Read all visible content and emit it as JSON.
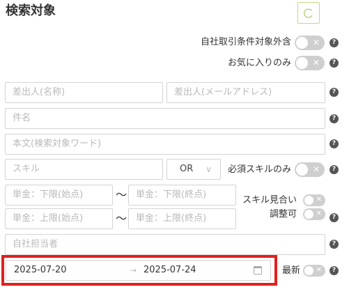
{
  "panel": {
    "title": "検索対象"
  },
  "reset": {
    "icon": "refresh-icon"
  },
  "toggles": {
    "exclude_own_company_label": "自社取引条件対象外含",
    "favorites_only_label": "お気に入りのみ",
    "required_skill_only_label": "必須スキルのみ",
    "skill_match_label": "スキル見合い",
    "adjustable_label": "調整可",
    "latest_label": "最新",
    "off_symbol": "✕"
  },
  "fields": {
    "sender_name_placeholder": "差出人(名称)",
    "sender_email_placeholder": "差出人(メールアドレス)",
    "subject_placeholder": "件名",
    "body_placeholder": "本文(検索対象ワード)",
    "skill_placeholder": "スキル",
    "skill_operator": "OR",
    "price_lower_start_placeholder": "単金：下限(始点)",
    "price_lower_end_placeholder": "単金：下限(終点)",
    "price_upper_start_placeholder": "単金：上限(始点)",
    "price_upper_end_placeholder": "単金：上限(終点)",
    "range_separator": "〜",
    "assignee_placeholder": "自社担当者"
  },
  "date_range": {
    "start": "2025-07-20",
    "separator": "→",
    "end": "2025-07-24"
  },
  "help_symbol": "?",
  "colors": {
    "toggle_off": "#cfcfcf",
    "highlight": "#e02020",
    "reset_border": "#c3d88a"
  }
}
